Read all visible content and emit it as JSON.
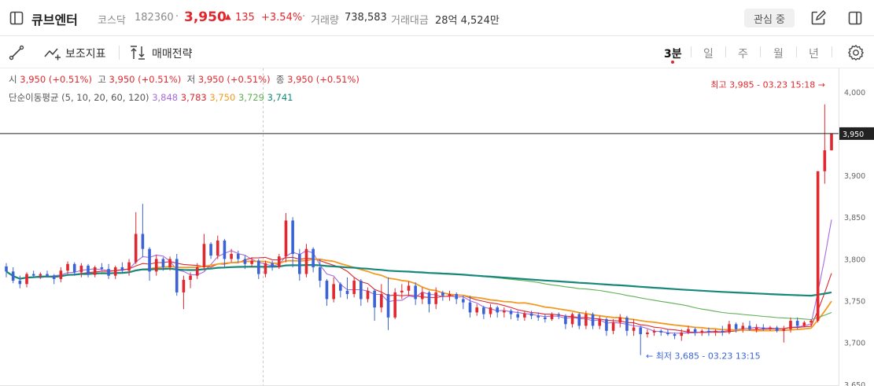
{
  "header": {
    "stock_name": "큐브엔터",
    "market": "코스닥",
    "code": "182360",
    "separator": "·",
    "price": "3,950",
    "change_arrow": "▲",
    "change": "135",
    "change_pct": "+3.54%",
    "volume_label": "거래량",
    "volume_value": "738,583",
    "value_label": "거래대금",
    "value_value": "28억 4,524만",
    "watch_button": "관심 중"
  },
  "toolbar": {
    "indicator_label": "보조지표",
    "strategy_label": "매매전략",
    "timeframes": [
      "3분",
      "일",
      "주",
      "월",
      "년"
    ],
    "active_timeframe": "3분"
  },
  "ohlc_legend": {
    "open_label": "시",
    "open_value": "3,950 (+0.51%)",
    "high_label": "고",
    "high_value": "3,950 (+0.51%)",
    "low_label": "저",
    "low_value": "3,950 (+0.51%)",
    "close_label": "종",
    "close_value": "3,950 (+0.51%)"
  },
  "ma_legend": {
    "label": "단순이동평균 (5, 10, 20, 60, 120)",
    "values": [
      {
        "value": "3,848",
        "color": "#a56be0"
      },
      {
        "value": "3,783",
        "color": "#e0282e"
      },
      {
        "value": "3,750",
        "color": "#f39a23"
      },
      {
        "value": "3,729",
        "color": "#5fb055"
      },
      {
        "value": "3,741",
        "color": "#17877a"
      }
    ]
  },
  "chart_data": {
    "type": "candlestick",
    "y_ticks": [
      4000,
      3950,
      3900,
      3850,
      3800,
      3750,
      3700,
      3650
    ],
    "y_tick_labels": [
      "4,000",
      "3,950",
      "3,900",
      "3,850",
      "3,800",
      "3,750",
      "3,700",
      "3,650"
    ],
    "ylim": [
      3648,
      4028
    ],
    "current_price": 3950,
    "current_price_label": "3,950",
    "high_annotation": "최고 3,985 - 03.23 15:18 →",
    "low_annotation": "← 최저 3,685 - 03.23 13:15",
    "up_color": "#e0282e",
    "down_color": "#3b63d6",
    "candles": [
      {
        "o": 3791,
        "h": 3795,
        "l": 3778,
        "c": 3785
      },
      {
        "o": 3785,
        "h": 3790,
        "l": 3771,
        "c": 3774
      },
      {
        "o": 3774,
        "h": 3780,
        "l": 3765,
        "c": 3770
      },
      {
        "o": 3770,
        "h": 3784,
        "l": 3766,
        "c": 3782
      },
      {
        "o": 3782,
        "h": 3786,
        "l": 3778,
        "c": 3780
      },
      {
        "o": 3780,
        "h": 3784,
        "l": 3776,
        "c": 3782
      },
      {
        "o": 3782,
        "h": 3786,
        "l": 3778,
        "c": 3780
      },
      {
        "o": 3780,
        "h": 3782,
        "l": 3770,
        "c": 3776
      },
      {
        "o": 3776,
        "h": 3790,
        "l": 3772,
        "c": 3786
      },
      {
        "o": 3786,
        "h": 3797,
        "l": 3782,
        "c": 3794
      },
      {
        "o": 3794,
        "h": 3796,
        "l": 3780,
        "c": 3784
      },
      {
        "o": 3784,
        "h": 3795,
        "l": 3778,
        "c": 3792
      },
      {
        "o": 3792,
        "h": 3794,
        "l": 3778,
        "c": 3781
      },
      {
        "o": 3781,
        "h": 3792,
        "l": 3778,
        "c": 3790
      },
      {
        "o": 3790,
        "h": 3795,
        "l": 3786,
        "c": 3788
      },
      {
        "o": 3788,
        "h": 3794,
        "l": 3776,
        "c": 3780
      },
      {
        "o": 3780,
        "h": 3792,
        "l": 3776,
        "c": 3790
      },
      {
        "o": 3790,
        "h": 3796,
        "l": 3784,
        "c": 3786
      },
      {
        "o": 3786,
        "h": 3800,
        "l": 3780,
        "c": 3796
      },
      {
        "o": 3796,
        "h": 3856,
        "l": 3794,
        "c": 3830
      },
      {
        "o": 3830,
        "h": 3866,
        "l": 3802,
        "c": 3812
      },
      {
        "o": 3812,
        "h": 3814,
        "l": 3774,
        "c": 3785
      },
      {
        "o": 3785,
        "h": 3805,
        "l": 3780,
        "c": 3800
      },
      {
        "o": 3800,
        "h": 3802,
        "l": 3786,
        "c": 3790
      },
      {
        "o": 3790,
        "h": 3803,
        "l": 3786,
        "c": 3800
      },
      {
        "o": 3800,
        "h": 3806,
        "l": 3756,
        "c": 3760
      },
      {
        "o": 3760,
        "h": 3780,
        "l": 3740,
        "c": 3775
      },
      {
        "o": 3775,
        "h": 3784,
        "l": 3765,
        "c": 3780
      },
      {
        "o": 3780,
        "h": 3795,
        "l": 3776,
        "c": 3790
      },
      {
        "o": 3790,
        "h": 3830,
        "l": 3786,
        "c": 3818
      },
      {
        "o": 3818,
        "h": 3820,
        "l": 3800,
        "c": 3804
      },
      {
        "o": 3804,
        "h": 3828,
        "l": 3800,
        "c": 3822
      },
      {
        "o": 3822,
        "h": 3824,
        "l": 3790,
        "c": 3800
      },
      {
        "o": 3800,
        "h": 3812,
        "l": 3796,
        "c": 3806
      },
      {
        "o": 3806,
        "h": 3810,
        "l": 3796,
        "c": 3800
      },
      {
        "o": 3800,
        "h": 3804,
        "l": 3788,
        "c": 3794
      },
      {
        "o": 3794,
        "h": 3802,
        "l": 3790,
        "c": 3798
      },
      {
        "o": 3798,
        "h": 3800,
        "l": 3776,
        "c": 3782
      },
      {
        "o": 3782,
        "h": 3798,
        "l": 3778,
        "c": 3795
      },
      {
        "o": 3795,
        "h": 3798,
        "l": 3786,
        "c": 3790
      },
      {
        "o": 3790,
        "h": 3806,
        "l": 3788,
        "c": 3803
      },
      {
        "o": 3803,
        "h": 3855,
        "l": 3796,
        "c": 3846
      },
      {
        "o": 3846,
        "h": 3850,
        "l": 3790,
        "c": 3806
      },
      {
        "o": 3806,
        "h": 3812,
        "l": 3774,
        "c": 3782
      },
      {
        "o": 3782,
        "h": 3818,
        "l": 3778,
        "c": 3812
      },
      {
        "o": 3812,
        "h": 3814,
        "l": 3784,
        "c": 3790
      },
      {
        "o": 3790,
        "h": 3800,
        "l": 3766,
        "c": 3774
      },
      {
        "o": 3774,
        "h": 3776,
        "l": 3744,
        "c": 3752
      },
      {
        "o": 3752,
        "h": 3778,
        "l": 3748,
        "c": 3770
      },
      {
        "o": 3770,
        "h": 3772,
        "l": 3754,
        "c": 3762
      },
      {
        "o": 3762,
        "h": 3778,
        "l": 3752,
        "c": 3758
      },
      {
        "o": 3758,
        "h": 3778,
        "l": 3754,
        "c": 3774
      },
      {
        "o": 3774,
        "h": 3776,
        "l": 3744,
        "c": 3752
      },
      {
        "o": 3752,
        "h": 3766,
        "l": 3748,
        "c": 3762
      },
      {
        "o": 3762,
        "h": 3764,
        "l": 3726,
        "c": 3742
      },
      {
        "o": 3742,
        "h": 3770,
        "l": 3736,
        "c": 3758
      },
      {
        "o": 3758,
        "h": 3778,
        "l": 3715,
        "c": 3730
      },
      {
        "o": 3730,
        "h": 3765,
        "l": 3728,
        "c": 3760
      },
      {
        "o": 3760,
        "h": 3770,
        "l": 3752,
        "c": 3762
      },
      {
        "o": 3762,
        "h": 3773,
        "l": 3756,
        "c": 3768
      },
      {
        "o": 3768,
        "h": 3772,
        "l": 3745,
        "c": 3752
      },
      {
        "o": 3752,
        "h": 3766,
        "l": 3746,
        "c": 3760
      },
      {
        "o": 3760,
        "h": 3762,
        "l": 3736,
        "c": 3746
      },
      {
        "o": 3746,
        "h": 3766,
        "l": 3740,
        "c": 3760
      },
      {
        "o": 3760,
        "h": 3762,
        "l": 3750,
        "c": 3756
      },
      {
        "o": 3756,
        "h": 3762,
        "l": 3750,
        "c": 3758
      },
      {
        "o": 3758,
        "h": 3760,
        "l": 3746,
        "c": 3752
      },
      {
        "o": 3752,
        "h": 3756,
        "l": 3740,
        "c": 3748
      },
      {
        "o": 3748,
        "h": 3756,
        "l": 3730,
        "c": 3736
      },
      {
        "o": 3736,
        "h": 3746,
        "l": 3732,
        "c": 3742
      },
      {
        "o": 3742,
        "h": 3744,
        "l": 3728,
        "c": 3734
      },
      {
        "o": 3734,
        "h": 3746,
        "l": 3730,
        "c": 3742
      },
      {
        "o": 3742,
        "h": 3744,
        "l": 3730,
        "c": 3736
      },
      {
        "o": 3736,
        "h": 3742,
        "l": 3730,
        "c": 3738
      },
      {
        "o": 3738,
        "h": 3740,
        "l": 3728,
        "c": 3734
      },
      {
        "o": 3734,
        "h": 3738,
        "l": 3726,
        "c": 3730
      },
      {
        "o": 3730,
        "h": 3738,
        "l": 3726,
        "c": 3735
      },
      {
        "o": 3735,
        "h": 3738,
        "l": 3728,
        "c": 3732
      },
      {
        "o": 3732,
        "h": 3736,
        "l": 3726,
        "c": 3730
      },
      {
        "o": 3730,
        "h": 3734,
        "l": 3724,
        "c": 3728
      },
      {
        "o": 3728,
        "h": 3736,
        "l": 3726,
        "c": 3734
      },
      {
        "o": 3734,
        "h": 3736,
        "l": 3728,
        "c": 3732
      },
      {
        "o": 3732,
        "h": 3734,
        "l": 3716,
        "c": 3722
      },
      {
        "o": 3722,
        "h": 3736,
        "l": 3718,
        "c": 3734
      },
      {
        "o": 3734,
        "h": 3736,
        "l": 3716,
        "c": 3720
      },
      {
        "o": 3720,
        "h": 3738,
        "l": 3716,
        "c": 3734
      },
      {
        "o": 3734,
        "h": 3736,
        "l": 3716,
        "c": 3720
      },
      {
        "o": 3720,
        "h": 3732,
        "l": 3716,
        "c": 3728
      },
      {
        "o": 3728,
        "h": 3730,
        "l": 3708,
        "c": 3714
      },
      {
        "o": 3714,
        "h": 3728,
        "l": 3710,
        "c": 3724
      },
      {
        "o": 3724,
        "h": 3734,
        "l": 3718,
        "c": 3730
      },
      {
        "o": 3730,
        "h": 3732,
        "l": 3708,
        "c": 3714
      },
      {
        "o": 3714,
        "h": 3728,
        "l": 3708,
        "c": 3718
      },
      {
        "o": 3718,
        "h": 3720,
        "l": 3685,
        "c": 3710
      },
      {
        "o": 3710,
        "h": 3716,
        "l": 3706,
        "c": 3712
      },
      {
        "o": 3712,
        "h": 3716,
        "l": 3708,
        "c": 3714
      },
      {
        "o": 3714,
        "h": 3716,
        "l": 3708,
        "c": 3712
      },
      {
        "o": 3712,
        "h": 3716,
        "l": 3708,
        "c": 3710
      },
      {
        "o": 3710,
        "h": 3712,
        "l": 3704,
        "c": 3708
      },
      {
        "o": 3708,
        "h": 3716,
        "l": 3702,
        "c": 3712
      },
      {
        "o": 3712,
        "h": 3720,
        "l": 3710,
        "c": 3716
      },
      {
        "o": 3716,
        "h": 3718,
        "l": 3708,
        "c": 3712
      },
      {
        "o": 3712,
        "h": 3716,
        "l": 3708,
        "c": 3714
      },
      {
        "o": 3714,
        "h": 3718,
        "l": 3708,
        "c": 3712
      },
      {
        "o": 3712,
        "h": 3716,
        "l": 3708,
        "c": 3714
      },
      {
        "o": 3714,
        "h": 3720,
        "l": 3708,
        "c": 3712
      },
      {
        "o": 3712,
        "h": 3726,
        "l": 3710,
        "c": 3722
      },
      {
        "o": 3722,
        "h": 3724,
        "l": 3712,
        "c": 3716
      },
      {
        "o": 3716,
        "h": 3724,
        "l": 3712,
        "c": 3720
      },
      {
        "o": 3720,
        "h": 3726,
        "l": 3714,
        "c": 3716
      },
      {
        "o": 3716,
        "h": 3722,
        "l": 3712,
        "c": 3718
      },
      {
        "o": 3718,
        "h": 3722,
        "l": 3714,
        "c": 3716
      },
      {
        "o": 3716,
        "h": 3720,
        "l": 3714,
        "c": 3718
      },
      {
        "o": 3718,
        "h": 3720,
        "l": 3712,
        "c": 3714
      },
      {
        "o": 3714,
        "h": 3720,
        "l": 3700,
        "c": 3716
      },
      {
        "o": 3716,
        "h": 3730,
        "l": 3712,
        "c": 3726
      },
      {
        "o": 3726,
        "h": 3730,
        "l": 3716,
        "c": 3720
      },
      {
        "o": 3720,
        "h": 3726,
        "l": 3718,
        "c": 3724
      },
      {
        "o": 3724,
        "h": 3728,
        "l": 3720,
        "c": 3726
      },
      {
        "o": 3726,
        "h": 3895,
        "l": 3724,
        "c": 3905
      },
      {
        "o": 3905,
        "h": 3985,
        "l": 3890,
        "c": 3930
      },
      {
        "o": 3930,
        "h": 3950,
        "l": 3930,
        "c": 3950
      }
    ],
    "moving_averages": [
      {
        "period": 5,
        "color": "#a56be0"
      },
      {
        "period": 10,
        "color": "#e0282e"
      },
      {
        "period": 20,
        "color": "#f39a23"
      },
      {
        "period": 60,
        "color": "#5fb055"
      },
      {
        "period": 120,
        "color": "#17877a"
      }
    ]
  }
}
